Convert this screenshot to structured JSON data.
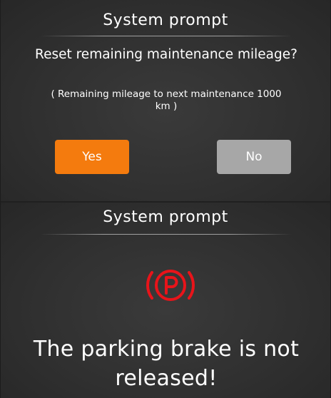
{
  "reset_prompt": {
    "title": "System prompt",
    "question": "Reset remaining maintenance mileage?",
    "note": "( Remaining mileage to next maintenance 1000 km )",
    "yes_label": "Yes",
    "no_label": "No",
    "colors": {
      "yes_button": "#f47b0e",
      "no_button": "#a7a7a7"
    }
  },
  "brake_prompt": {
    "title": "System prompt",
    "icon": "parking-brake-icon",
    "icon_color": "#e8141a",
    "message": "The parking brake is not released!"
  }
}
